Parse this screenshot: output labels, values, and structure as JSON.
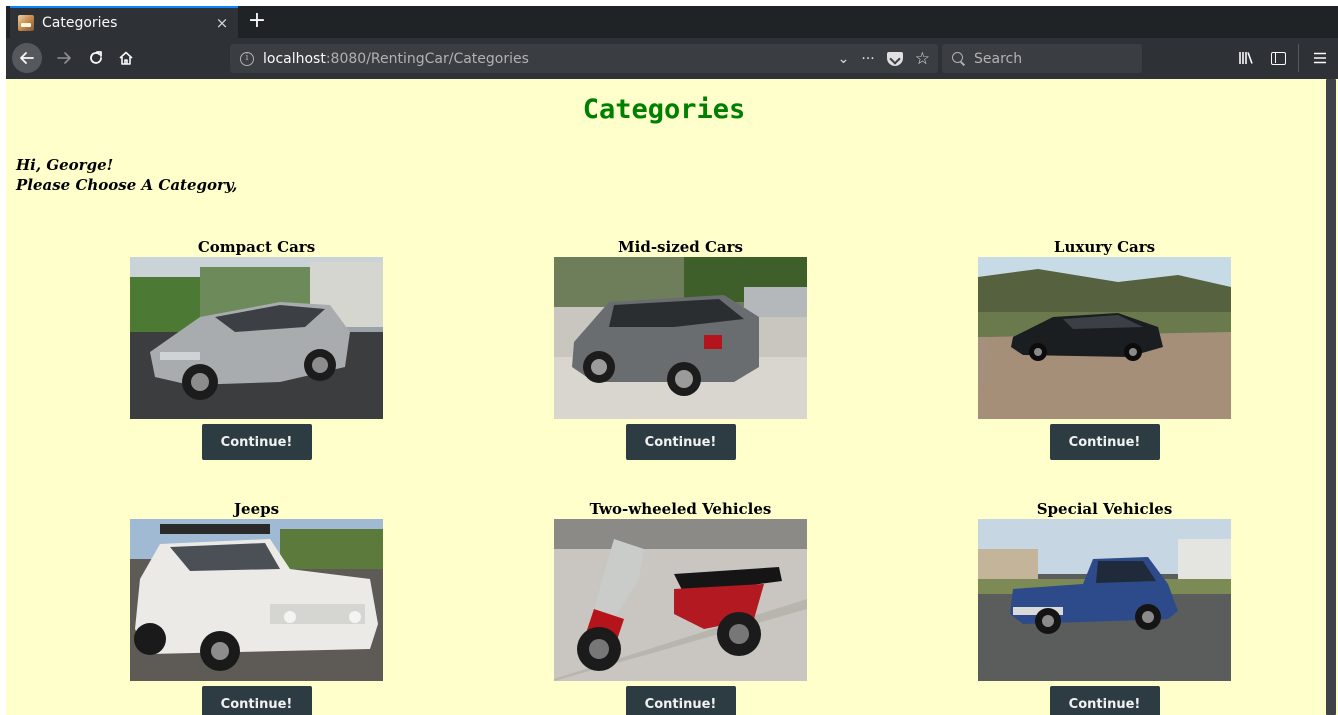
{
  "browser": {
    "tab_title": "Categories",
    "tab_close": "×",
    "new_tab": "+",
    "url_host": "localhost",
    "url_rest": ":8080/RentingCar/Categories",
    "url_actions": [
      "⌄",
      "···",
      "☆"
    ],
    "search_placeholder": "Search",
    "icons": [
      "back-arrow-icon",
      "forward-arrow-icon",
      "reload-icon",
      "home-icon",
      "info-icon",
      "pocket-icon",
      "bookmark-star-icon",
      "search-icon",
      "library-icon",
      "sidebar-icon",
      "menu-icon"
    ]
  },
  "page": {
    "title": "Categories",
    "greeting_line1": "Hi, George!",
    "greeting_line2": "Please Choose A Category,",
    "background": "#ffffcc",
    "title_color": "#008000"
  },
  "categories": [
    {
      "name": "Compact Cars",
      "button": "Continue!"
    },
    {
      "name": "Mid-sized Cars",
      "button": "Continue!"
    },
    {
      "name": "Luxury Cars",
      "button": "Continue!"
    },
    {
      "name": "Jeeps",
      "button": "Continue!"
    },
    {
      "name": "Two-wheeled Vehicles",
      "button": "Continue!"
    },
    {
      "name": "Special Vehicles",
      "button": "Continue!"
    }
  ]
}
